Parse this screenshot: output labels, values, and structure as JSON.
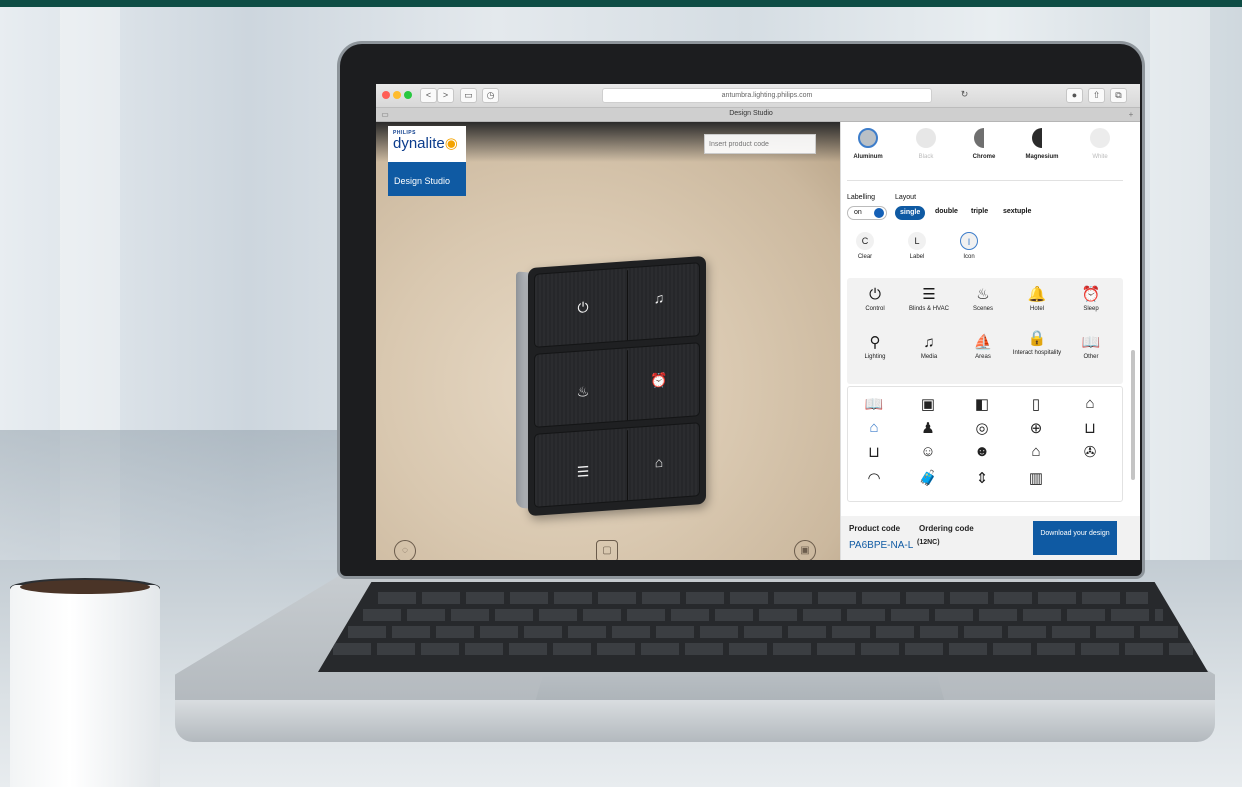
{
  "browser": {
    "url": "antumbra.lighting.philips.com",
    "tab_title": "Design Studio",
    "reload_icon": "reload-icon",
    "nav_back": "<",
    "nav_forward": ">"
  },
  "brand": {
    "philips": "PHILIPS",
    "dynalite": "dynalite",
    "design_studio": "Design Studio"
  },
  "viewer": {
    "code_placeholder": "Insert product code"
  },
  "finish": {
    "options": [
      {
        "label": "Aluminum",
        "color": "#b9c0c6"
      },
      {
        "label": "Black",
        "color": "#e7e7e7"
      },
      {
        "label": "Chrome",
        "color": "#8e8e8e"
      },
      {
        "label": "Magnesium",
        "color": "#3a3a3a"
      },
      {
        "label": "White",
        "color": "#ececec"
      }
    ]
  },
  "labelling": {
    "title": "Labelling",
    "toggle": "on"
  },
  "layout": {
    "title": "Layout",
    "options": [
      "single",
      "double",
      "triple",
      "sextuple"
    ],
    "active": "single"
  },
  "modes": [
    {
      "glyph": "C",
      "label": "Clear"
    },
    {
      "glyph": "L",
      "label": "Label"
    },
    {
      "glyph": "I",
      "label": "Icon"
    }
  ],
  "categories": [
    {
      "icon": "power-icon",
      "glyph": "⏻",
      "label": "Control"
    },
    {
      "icon": "blinds-icon",
      "glyph": "☰",
      "label": "Blinds & HVAC"
    },
    {
      "icon": "scenes-icon",
      "glyph": "♨",
      "label": "Scenes"
    },
    {
      "icon": "hotel-bell-icon",
      "glyph": "🔔",
      "label": "Hotel"
    },
    {
      "icon": "alarm-icon",
      "glyph": "⏰",
      "label": "Sleep"
    },
    {
      "icon": "lamp-icon",
      "glyph": "⚲",
      "label": "Lighting"
    },
    {
      "icon": "music-icon",
      "glyph": "♫",
      "label": "Media"
    },
    {
      "icon": "areas-icon",
      "glyph": "⛵",
      "label": "Areas"
    },
    {
      "icon": "lock-icon",
      "glyph": "🔒",
      "label": "Interact hospitality"
    },
    {
      "icon": "book-icon",
      "glyph": "📖",
      "label": "Other"
    }
  ],
  "icon_grid": [
    {
      "icon": "open-book-icon",
      "glyph": "📖",
      "accent": false
    },
    {
      "icon": "book-solid-icon",
      "glyph": "▣",
      "accent": false
    },
    {
      "icon": "door-icon",
      "glyph": "◧",
      "accent": false
    },
    {
      "icon": "door-open-icon",
      "glyph": "▯",
      "accent": false
    },
    {
      "icon": "house-icon",
      "glyph": "⌂",
      "accent": false
    },
    {
      "icon": "house-blue-icon",
      "glyph": "⌂",
      "accent": true
    },
    {
      "icon": "person-icon",
      "glyph": "♟",
      "accent": false
    },
    {
      "icon": "target-icon",
      "glyph": "◎",
      "accent": false
    },
    {
      "icon": "plus-circle-icon",
      "glyph": "⊕",
      "accent": false
    },
    {
      "icon": "bed-icon",
      "glyph": "⊔",
      "accent": false
    },
    {
      "icon": "bed-alt-icon",
      "glyph": "⊔",
      "accent": false
    },
    {
      "icon": "smile-icon",
      "glyph": "☺",
      "accent": false
    },
    {
      "icon": "smile-solid-icon",
      "glyph": "☻",
      "accent": false
    },
    {
      "icon": "home-arrow-icon",
      "glyph": "⌂",
      "accent": false
    },
    {
      "icon": "fan-icon",
      "glyph": "✇",
      "accent": false
    },
    {
      "icon": "gauge-icon",
      "glyph": "◠",
      "accent": false
    },
    {
      "icon": "luggage-icon",
      "glyph": "🧳",
      "accent": false
    },
    {
      "icon": "elevator-icon",
      "glyph": "⇕",
      "accent": false
    },
    {
      "icon": "cabinet-icon",
      "glyph": "▥",
      "accent": false
    }
  ],
  "switch_icons": [
    "⏻",
    "♫",
    "♨",
    "⏰",
    "☰",
    "⌂"
  ],
  "footer": {
    "product_code_label": "Product code",
    "ordering_code_label": "Ordering code",
    "product_code": "PA6BPE-NA-L",
    "ordering_code": "(12NC)",
    "download_label": "Download your design"
  },
  "colors": {
    "accent": "#0f5aa3",
    "brand_bar": "#0e4d45"
  }
}
